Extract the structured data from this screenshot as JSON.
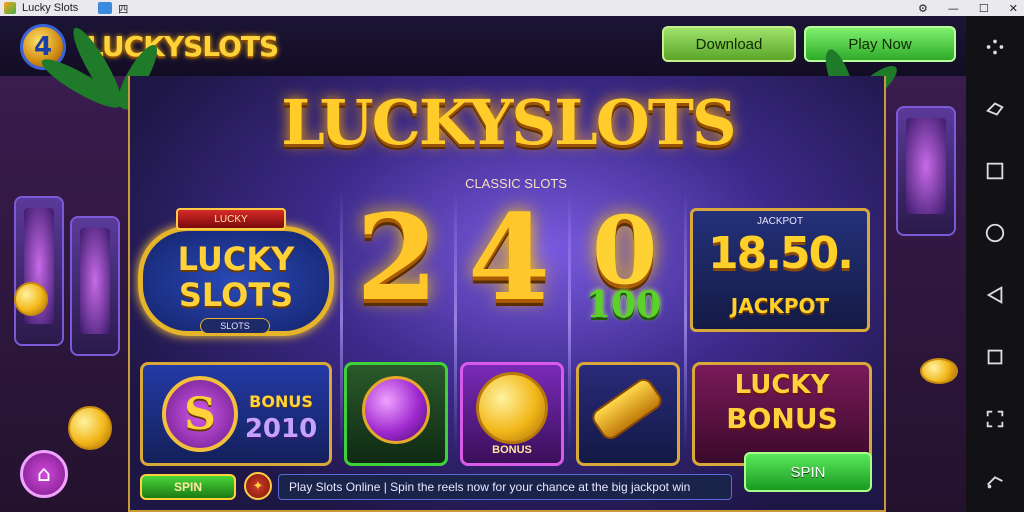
{
  "window": {
    "title": "Lucky Slots",
    "tab_text": "四",
    "controls": [
      "⚙",
      "—",
      "☐",
      "✕"
    ]
  },
  "header": {
    "logo_number": "4",
    "logo_text": "LUCKYSLOTS",
    "button_1": "Download",
    "button_2": "Play Now"
  },
  "hero": {
    "title": "LUCKYSLOTS",
    "subtitle": "CLASSIC SLOTS"
  },
  "left_badge": {
    "ribbon": "LUCKY",
    "line1": "LUCKY",
    "line2": "SLOTS",
    "footer": "SLOTS"
  },
  "reels": {
    "reel_1": "2",
    "reel_2": "4",
    "reel_3": "0",
    "reel_3_small": "100"
  },
  "jackpot": {
    "header": "JACKPOT",
    "value": "18.50.",
    "label": "JACKPOT"
  },
  "tiles": {
    "tile_a_symbol": "S",
    "tile_a_text1": "BONUS",
    "tile_a_text2": "2010",
    "tile_c_label": "BONUS",
    "tile_e_line1": "LUCKY",
    "tile_e_line2": "BONUS"
  },
  "controls": {
    "spin": "SPIN",
    "pill": "SPIN",
    "ticker": "Play Slots Online | Spin the reels now for your chance at the big jackpot win"
  },
  "android_nav": [
    "dots",
    "share",
    "square",
    "circle",
    "triangle",
    "square-small",
    "expand",
    "rotate"
  ],
  "colors": {
    "gold": "#ffcc2a",
    "green_button": "#2faa2a",
    "frame_gold": "#c99a3a"
  }
}
